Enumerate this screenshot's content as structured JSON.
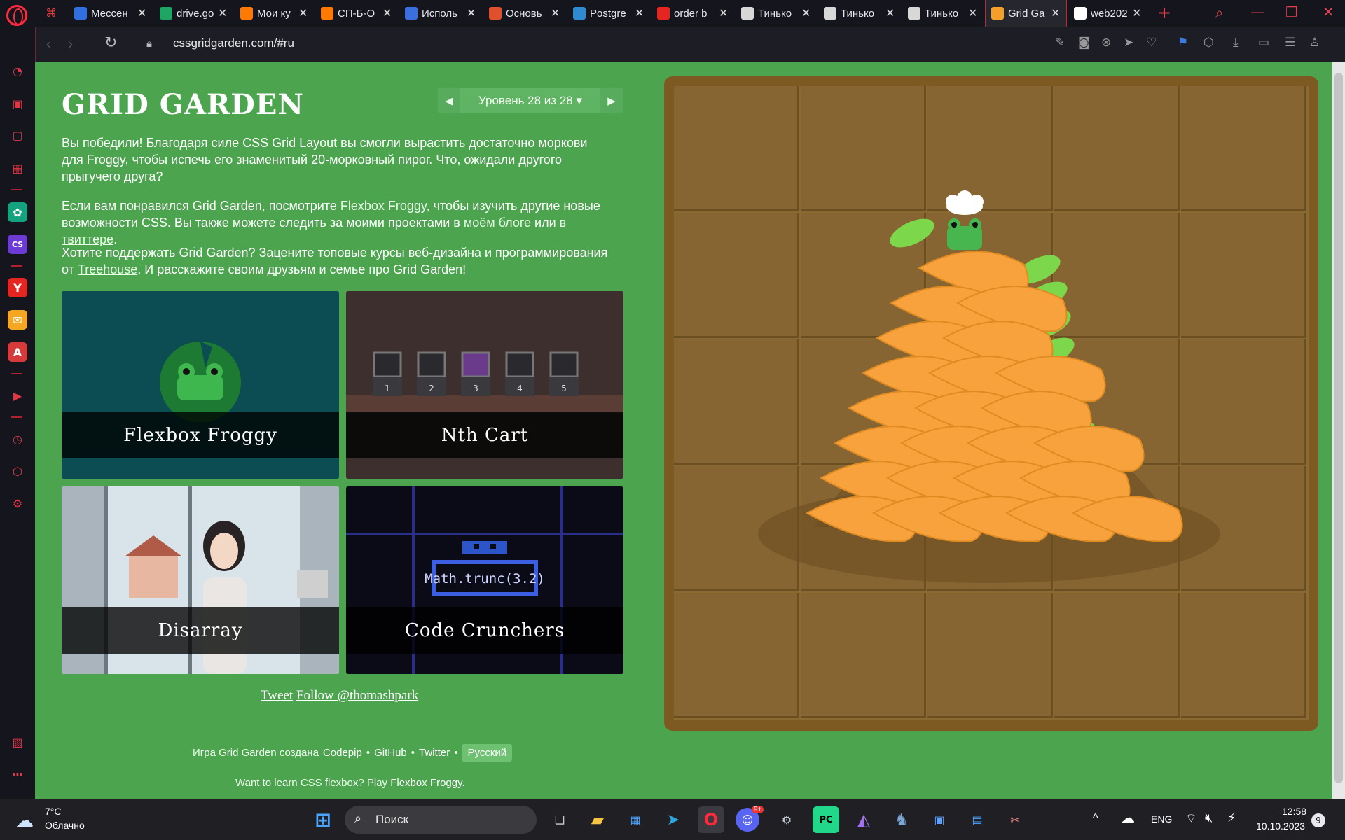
{
  "browser": {
    "tabs": [
      {
        "title": "Мессен",
        "favicon": "chat-bubble",
        "color": "#2f6fe0"
      },
      {
        "title": "drive.go",
        "favicon": "drive-triangle",
        "color": "#1fa463"
      },
      {
        "title": "Мои ку",
        "favicon": "stepik",
        "color": "#ff7a00"
      },
      {
        "title": "СП-Б-О",
        "favicon": "stepik",
        "color": "#ff7a00"
      },
      {
        "title": "Исполь",
        "favicon": "code-arrows",
        "color": "#3b6fe0"
      },
      {
        "title": "Основь",
        "favicon": "circle-o",
        "color": "#e0502a"
      },
      {
        "title": "Postgre",
        "favicon": "elephant",
        "color": "#2f8ad0"
      },
      {
        "title": "order b",
        "favicon": "yandex",
        "color": "#e52620"
      },
      {
        "title": "Тинько",
        "favicon": "shield",
        "color": "#d8d8d8"
      },
      {
        "title": "Тинько",
        "favicon": "shield",
        "color": "#d8d8d8"
      },
      {
        "title": "Тинько",
        "favicon": "shield",
        "color": "#d8d8d8"
      },
      {
        "title": "Grid Ga",
        "favicon": "carrot",
        "color": "#f59e2a",
        "active": true
      },
      {
        "title": "web202",
        "favicon": "github",
        "color": "#ffffff"
      }
    ],
    "url": "cssgridgarden.com/#ru"
  },
  "page": {
    "title": "GRID GARDEN",
    "level_label": "Уровень 28 из 28",
    "prev_arrow": "◀",
    "next_arrow": "▶",
    "dropdown_arrow": "▾",
    "p1": "Вы победили! Благодаря силе CSS Grid Layout вы смогли вырастить достаточно моркови для Froggy, чтобы испечь его знаменитый 20-морковный пирог. Что, ожидали другого прыгучего друга?",
    "p2_before": "Если вам понравился Grid Garden, посмотрите ",
    "p2_link1": "Flexbox Froggy",
    "p2_mid": ", чтобы изучить другие новые возможности CSS. Вы также можете следить за моими проектами в ",
    "p2_link2": "моём блоге",
    "p2_mid2": " или ",
    "p2_link3": "в твиттере",
    "p2_end": ".",
    "p3_before": "Хотите поддержать Grid Garden? Зацените топовые курсы веб-дизайна и программирования от ",
    "p3_link": "Treehouse",
    "p3_end": ". И расскажите своим друзьям и семье про Grid Garden!",
    "cards": [
      {
        "title": "Flexbox Froggy"
      },
      {
        "title": "Nth Cart"
      },
      {
        "title": "Disarray"
      },
      {
        "title": "Code Crunchers"
      }
    ],
    "cart_numbers": [
      "1",
      "2",
      "3",
      "4",
      "5"
    ],
    "code_text": "Math.trunc(3.2)",
    "share_tweet": "Tweet",
    "share_follow": "Follow @thomashpark",
    "credits_text": "Игра Grid Garden создана",
    "credits_codepip": "Codepip",
    "credits_github": "GitHub",
    "credits_twitter": "Twitter",
    "bullet": "•",
    "language": "Русский",
    "learn_text": "Want to learn CSS flexbox? Play ",
    "learn_link": "Flexbox Froggy",
    "learn_end": "."
  },
  "taskbar": {
    "weather_temp": "7°C",
    "weather_desc": "Облачно",
    "search_placeholder": "Поиск",
    "lang": "ENG",
    "time": "12:58",
    "date": "10.10.2023",
    "notifications": "9",
    "discord_badge": "9+"
  },
  "colors": {
    "page_bg": "#4ca44f",
    "garden_border": "#7d5a22",
    "soil": "#876532",
    "carrot": "#f7a23c",
    "leaf": "#7cd84a",
    "opera_red": "#ff2b3d"
  }
}
